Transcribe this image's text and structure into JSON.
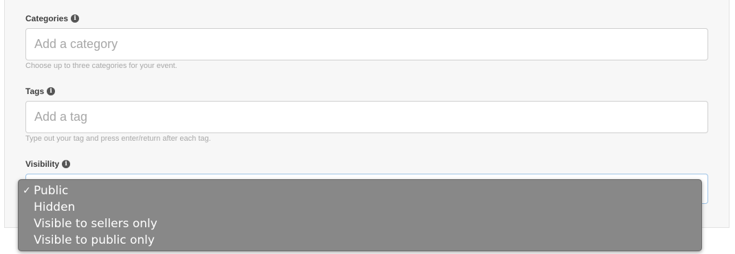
{
  "categories": {
    "label": "Categories",
    "placeholder": "Add a category",
    "help": "Choose up to three categories for your event."
  },
  "tags": {
    "label": "Tags",
    "placeholder": "Add a tag",
    "help": "Type out your tag and press enter/return after each tag."
  },
  "visibility": {
    "label": "Visibility",
    "selected": "Public",
    "options": [
      {
        "label": "Public",
        "checked": true
      },
      {
        "label": "Hidden",
        "checked": false
      },
      {
        "label": "Visible to sellers only",
        "checked": false
      },
      {
        "label": "Visible to public only",
        "checked": false
      }
    ]
  },
  "icons": {
    "info": "info-icon",
    "check": "checkmark-icon",
    "info_glyph": "i",
    "check_glyph": "✓"
  },
  "colors": {
    "dropdown_bg": "#888888",
    "focus_border": "#9ec3e6"
  }
}
